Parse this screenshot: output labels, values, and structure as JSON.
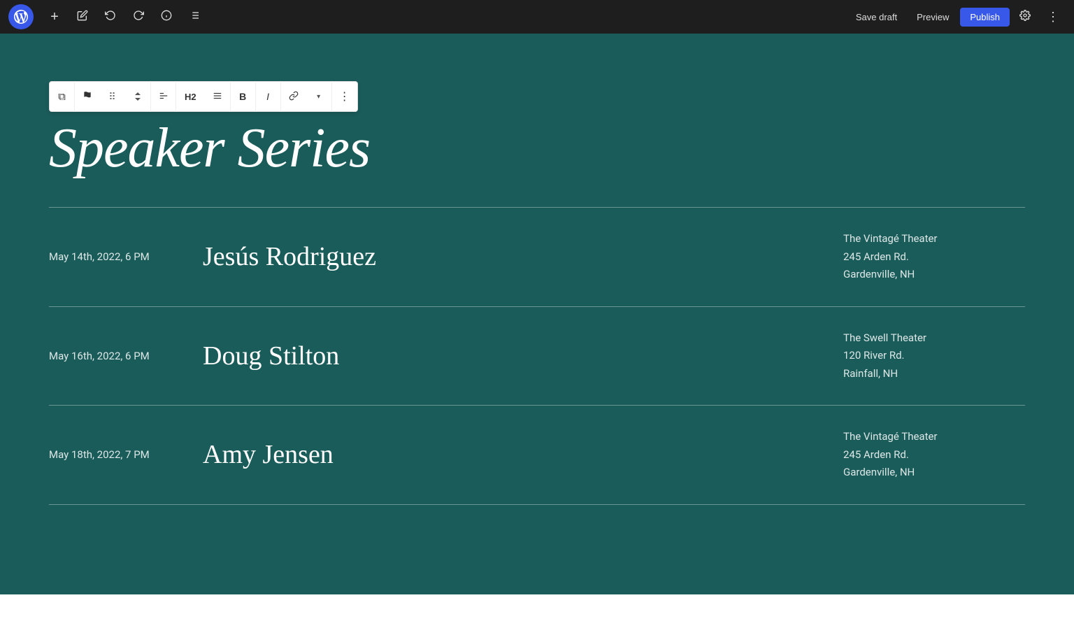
{
  "toolbar": {
    "wp_logo_alt": "WordPress",
    "add_label": "+",
    "edit_label": "✎",
    "undo_label": "↩",
    "redo_label": "↪",
    "info_label": "ℹ",
    "list_label": "≡",
    "save_draft_label": "Save draft",
    "preview_label": "Preview",
    "publish_label": "Publish",
    "settings_label": "⚙",
    "more_label": "⋮"
  },
  "block_toolbar": {
    "copy_icon": "⧉",
    "flag_icon": "⚑",
    "drag_icon": "⠿",
    "align_left_icon": "▤",
    "heading_label": "H2",
    "align_text_icon": "≡",
    "bold_label": "B",
    "italic_label": "I",
    "link_label": "⊕",
    "chevron_icon": "˅",
    "more_icon": "⋮"
  },
  "page": {
    "title": "Speaker Series"
  },
  "events": [
    {
      "date": "May 14th, 2022, 6 PM",
      "speaker": "Jesús Rodriguez",
      "venue": "The Vintagé Theater",
      "address": "245 Arden Rd.",
      "city": "Gardenville, NH"
    },
    {
      "date": "May 16th, 2022, 6 PM",
      "speaker": "Doug Stilton",
      "venue": "The Swell Theater",
      "address": "120 River Rd.",
      "city": "Rainfall, NH"
    },
    {
      "date": "May 18th, 2022, 7 PM",
      "speaker": "Amy Jensen",
      "venue": "The Vintagé Theater",
      "address": "245 Arden Rd.",
      "city": "Gardenville, NH"
    }
  ]
}
